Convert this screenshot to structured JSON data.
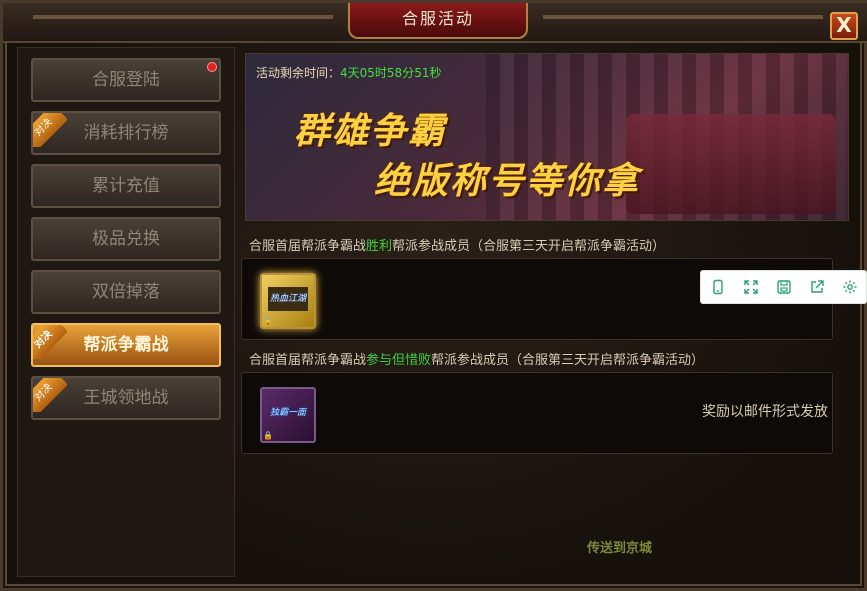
{
  "window": {
    "title": "合服活动",
    "close_label": "X"
  },
  "sidebar": {
    "items": [
      {
        "label": "合服登陆",
        "tag": "",
        "active": false,
        "dot": true
      },
      {
        "label": "消耗排行榜",
        "tag": "对决",
        "active": false,
        "dot": false
      },
      {
        "label": "累计充值",
        "tag": "",
        "active": false,
        "dot": false
      },
      {
        "label": "极品兑换",
        "tag": "",
        "active": false,
        "dot": false
      },
      {
        "label": "双倍掉落",
        "tag": "",
        "active": false,
        "dot": false
      },
      {
        "label": "帮派争霸战",
        "tag": "对决",
        "active": true,
        "dot": false
      },
      {
        "label": "王城领地战",
        "tag": "对决",
        "active": false,
        "dot": false
      }
    ]
  },
  "banner": {
    "timer_label": "活动剩余时间：",
    "timer_value": "4天05时58分51秒",
    "slogan_line1": "群雄争霸",
    "slogan_line2": "绝版称号等你拿"
  },
  "section1": {
    "prefix": "合服首届帮派争霸战",
    "highlight": "胜利",
    "suffix": "帮派参战成员（合服第三天开启帮派争霸活动）",
    "item_title": "热血江湖",
    "mail_text": ""
  },
  "section2": {
    "prefix": "合服首届帮派争霸战",
    "highlight": "参与但惜败",
    "suffix": "帮派参战成员（合服第三天开启帮派争霸活动）",
    "item_title": "独霸一面",
    "mail_text": "奖励以邮件形式发放"
  },
  "footer": {
    "teleport_label": "传送到京城"
  },
  "colors": {
    "accent_green": "#40d040",
    "active_tab": "#e8a238"
  },
  "toolbar": {
    "icons": [
      "phone-icon",
      "expand-icon",
      "save-icon",
      "share-icon",
      "settings-icon"
    ]
  }
}
